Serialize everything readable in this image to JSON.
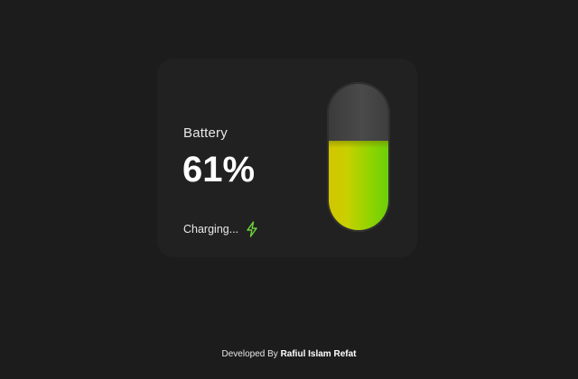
{
  "card": {
    "label": "Battery",
    "percent_text": "61%",
    "status_text": "Charging...",
    "status_icon": "lightning-bolt-icon",
    "level": 0.61,
    "colors": {
      "card_bg": "#212121",
      "page_bg": "#1c1c1c",
      "fill_start": "#d2c500",
      "fill_end": "#6ccf0a",
      "bolt": "#6fd43a"
    }
  },
  "footer": {
    "prefix": "Developed By",
    "author": "Rafiul Islam Refat"
  }
}
